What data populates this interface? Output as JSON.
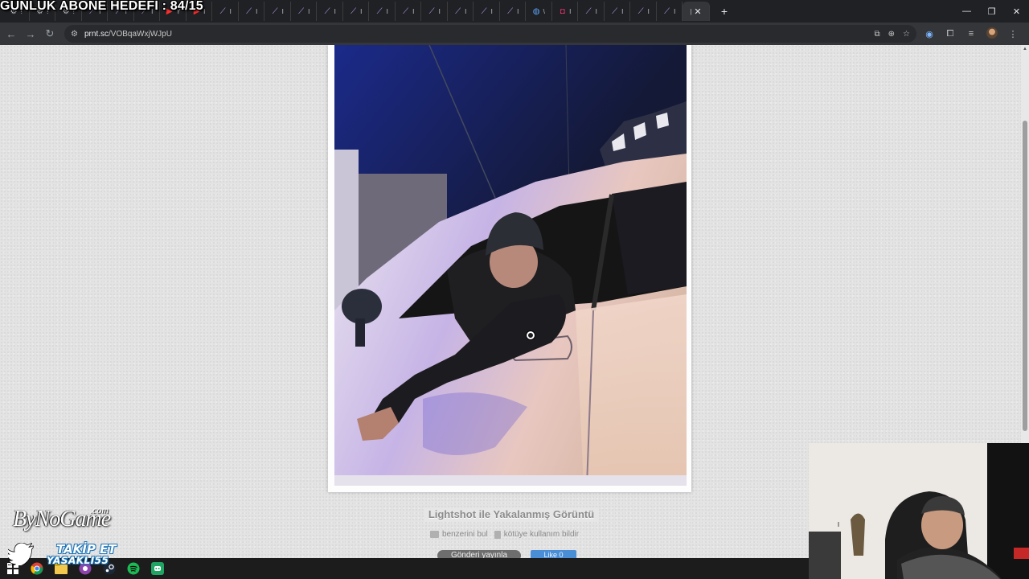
{
  "overlay": {
    "stream_title": "GÜNLÜK ABONE HEDEFİ : 84/15",
    "brand_logo": "ByNoGame",
    "brand_suffix": ".com",
    "follow_label": "TAKİP ET",
    "follow_handle": "YASAKLI55"
  },
  "browser": {
    "tabs": [
      {
        "icon": "settings-favicon",
        "label": "!"
      },
      {
        "icon": "settings-favicon",
        "label": "!"
      },
      {
        "icon": "settings-favicon",
        "label": "!"
      },
      {
        "icon": "feather-favicon",
        "label": "I"
      },
      {
        "icon": "feather-favicon",
        "label": "I"
      },
      {
        "icon": "feather-favicon",
        "label": "I"
      },
      {
        "icon": "youtube-favicon",
        "label": "Y"
      },
      {
        "icon": "youtube-favicon",
        "label": "I"
      },
      {
        "icon": "feather-favicon",
        "label": "I"
      },
      {
        "icon": "feather-favicon",
        "label": "I"
      },
      {
        "icon": "feather-favicon",
        "label": "I"
      },
      {
        "icon": "feather-favicon",
        "label": "I"
      },
      {
        "icon": "feather-favicon",
        "label": "I"
      },
      {
        "icon": "feather-favicon",
        "label": "I"
      },
      {
        "icon": "feather-favicon",
        "label": "I"
      },
      {
        "icon": "feather-favicon",
        "label": "I"
      },
      {
        "icon": "feather-favicon",
        "label": "I"
      },
      {
        "icon": "feather-favicon",
        "label": "I"
      },
      {
        "icon": "feather-favicon",
        "label": "I"
      },
      {
        "icon": "feather-favicon",
        "label": "I"
      },
      {
        "icon": "copilot-favicon",
        "label": "\\"
      },
      {
        "icon": "instagram-favicon",
        "label": "I"
      },
      {
        "icon": "feather-favicon",
        "label": "I"
      },
      {
        "icon": "feather-favicon",
        "label": "I"
      },
      {
        "icon": "feather-favicon",
        "label": "I"
      },
      {
        "icon": "feather-favicon",
        "label": "I"
      }
    ],
    "url_host": "prnt.sc",
    "url_path": "/VOBqaWxjWJpU"
  },
  "page": {
    "caption": "Lightshot ile Yakalanmış Görüntü",
    "similar_link": "benzerini bul",
    "report_link": "kötüye kullanım bildir",
    "send_button": "Gönderi yayınla",
    "like_button": "Like 0"
  },
  "colors": {
    "chrome_dark": "#202124",
    "page_bg": "#e3e3e3",
    "like_blue": "#4a8fd6"
  }
}
